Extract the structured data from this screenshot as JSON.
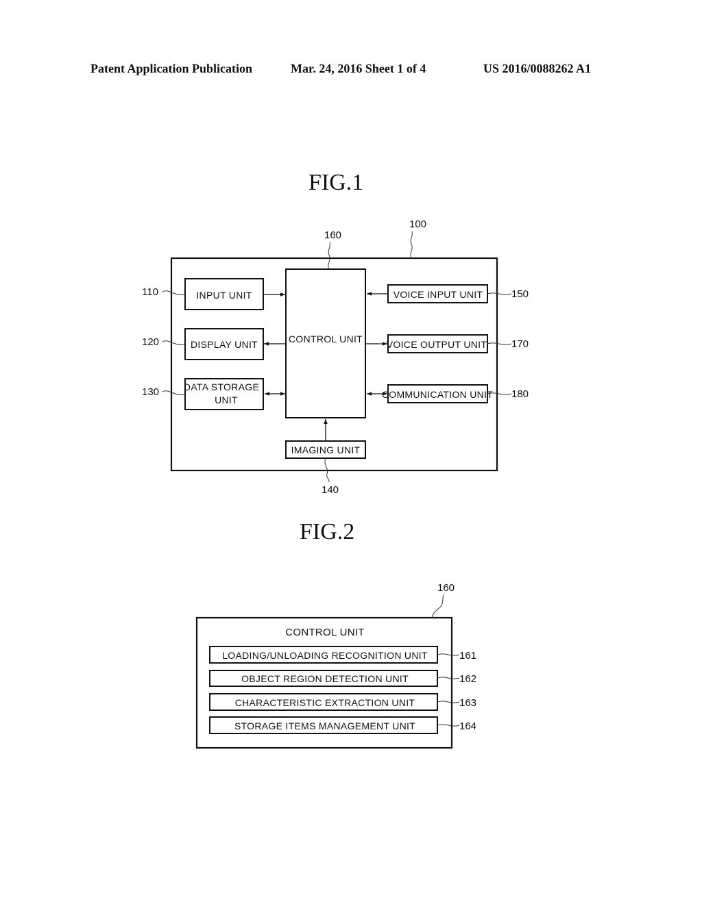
{
  "header": {
    "publication": "Patent Application Publication",
    "date_sheet": "Mar. 24, 2016  Sheet 1 of 4",
    "number": "US 2016/0088262 A1"
  },
  "fig1": {
    "title": "FIG.1",
    "device_ref": "100",
    "control": {
      "label": "CONTROL UNIT",
      "ref": "160"
    },
    "left_units": [
      {
        "label": "INPUT UNIT",
        "ref": "110",
        "arrow": "to-control"
      },
      {
        "label": "DISPLAY UNIT",
        "ref": "120",
        "arrow": "from-control"
      },
      {
        "label_line1": "DATA STORAGE",
        "label_line2": "UNIT",
        "ref": "130",
        "arrow": "bidirectional"
      }
    ],
    "right_units": [
      {
        "label": "VOICE INPUT UNIT",
        "ref": "150",
        "arrow": "to-control"
      },
      {
        "label": "VOICE OUTPUT UNIT",
        "ref": "170",
        "arrow": "from-control"
      },
      {
        "label": "COMMUNICATION UNIT",
        "ref": "180",
        "arrow": "bidirectional"
      }
    ],
    "bottom_unit": {
      "label": "IMAGING UNIT",
      "ref": "140",
      "arrow": "to-control"
    }
  },
  "fig2": {
    "title": "FIG.2",
    "ref": "160",
    "label": "CONTROL UNIT",
    "sub_units": [
      {
        "label": "LOADING/UNLOADING RECOGNITION UNIT",
        "ref": "161"
      },
      {
        "label": "OBJECT REGION DETECTION UNIT",
        "ref": "162"
      },
      {
        "label": "CHARACTERISTIC EXTRACTION UNIT",
        "ref": "163"
      },
      {
        "label": "STORAGE ITEMS MANAGEMENT UNIT",
        "ref": "164"
      }
    ]
  }
}
